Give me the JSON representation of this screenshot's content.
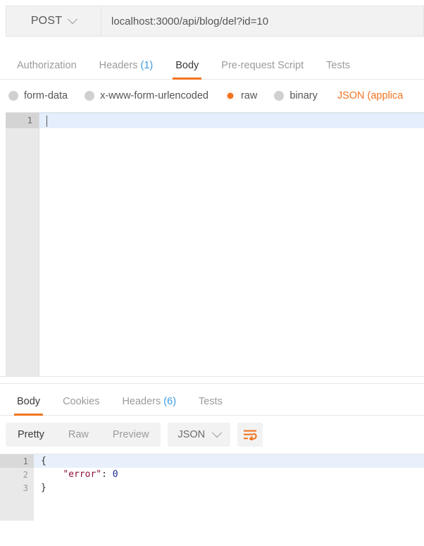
{
  "request": {
    "method": "POST",
    "method_caret_icon": "chevron-down-icon",
    "url": "localhost:3000/api/blog/del?id=10",
    "url_placeholder": "Enter request URL",
    "tabs": [
      {
        "label": "Authorization",
        "count": "",
        "active": false
      },
      {
        "label": "Headers",
        "count": "(1)",
        "active": false
      },
      {
        "label": "Body",
        "count": "",
        "active": true
      },
      {
        "label": "Pre-request Script",
        "count": "",
        "active": false
      },
      {
        "label": "Tests",
        "count": "",
        "active": false
      }
    ],
    "body_types": [
      {
        "label": "form-data",
        "checked": false
      },
      {
        "label": "x-www-form-urlencoded",
        "checked": false
      },
      {
        "label": "raw",
        "checked": true
      },
      {
        "label": "binary",
        "checked": false
      }
    ],
    "content_type": "JSON (applica",
    "editor": {
      "line_numbers": [
        "1"
      ],
      "content": ""
    }
  },
  "response": {
    "tabs": [
      {
        "label": "Body",
        "count": "",
        "active": true
      },
      {
        "label": "Cookies",
        "count": "",
        "active": false
      },
      {
        "label": "Headers",
        "count": "(6)",
        "active": false
      },
      {
        "label": "Tests",
        "count": "",
        "active": false
      }
    ],
    "view_modes": [
      {
        "label": "Pretty",
        "active": true
      },
      {
        "label": "Raw",
        "active": false
      },
      {
        "label": "Preview",
        "active": false
      }
    ],
    "format": "JSON",
    "format_caret_icon": "chevron-down-icon",
    "wrap_icon": "word-wrap-icon",
    "body_lines": [
      {
        "num": "1",
        "fold": true,
        "plain": "{"
      },
      {
        "num": "2",
        "fold": false,
        "key": "\"error\"",
        "sep": ": ",
        "num_val": "0",
        "indent": "    "
      },
      {
        "num": "3",
        "fold": false,
        "plain": "}"
      }
    ]
  },
  "colors": {
    "accent": "#f2741f",
    "link": "#3a9ae0",
    "panel": "#f2f2f2",
    "gutter": "#e9e9e9",
    "active_line": "#e4eefc"
  }
}
